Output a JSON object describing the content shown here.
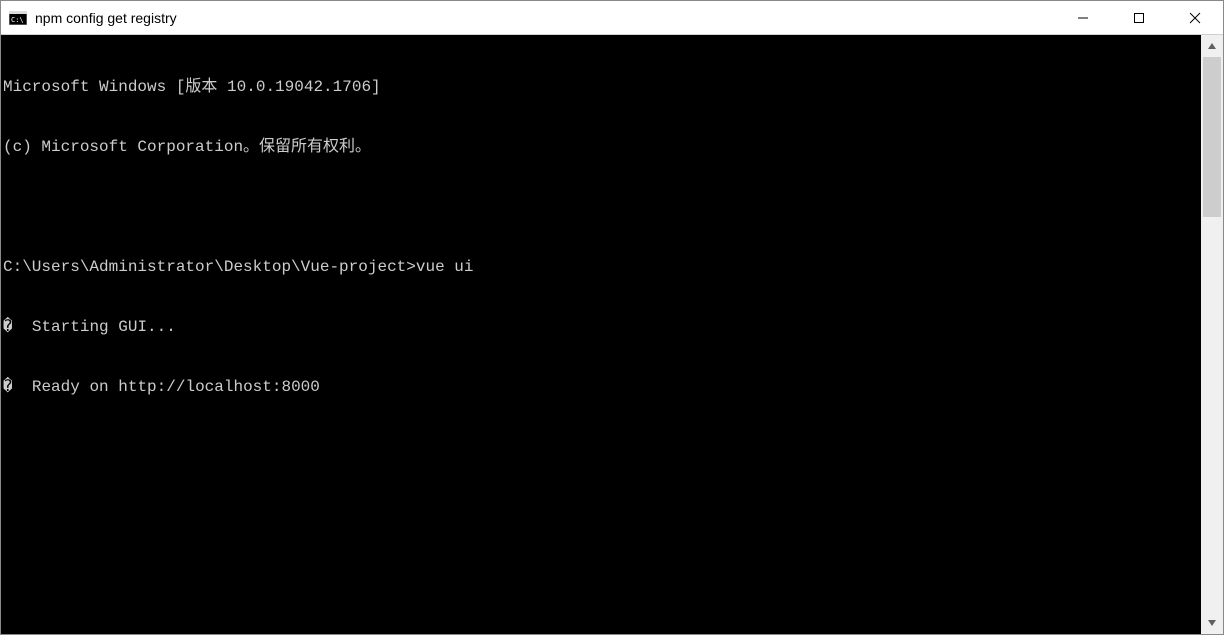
{
  "titlebar": {
    "icon_name": "cmd-icon",
    "title": "npm config get registry"
  },
  "console": {
    "lines": [
      "Microsoft Windows [版本 10.0.19042.1706]",
      "(c) Microsoft Corporation。保留所有权利。",
      "",
      "C:\\Users\\Administrator\\Desktop\\Vue-project>vue ui",
      "�  Starting GUI...",
      "�  Ready on http://localhost:8000"
    ]
  }
}
